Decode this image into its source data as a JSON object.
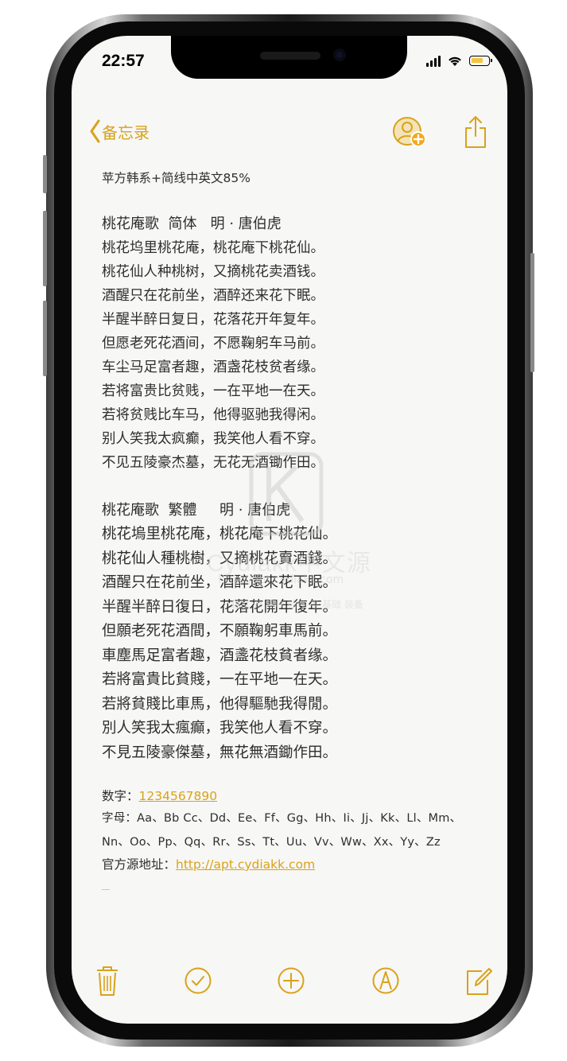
{
  "status": {
    "time": "22:57"
  },
  "nav": {
    "back_label": "备忘录"
  },
  "note": {
    "title_line": "苹方韩系+简线中英文85%",
    "simplified": {
      "heading": "桃花庵歌  简体   明 · 唐伯虎",
      "lines": [
        "桃花坞里桃花庵，桃花庵下桃花仙。",
        "桃花仙人种桃树，又摘桃花卖酒钱。",
        "酒醒只在花前坐，酒醉还来花下眠。",
        "半醒半醉日复日，花落花开年复年。",
        "但愿老死花酒间，不愿鞠躬车马前。",
        "车尘马足富者趣，酒盏花枝贫者缘。",
        "若将富贵比贫贱，一在平地一在天。",
        "若将贫贱比车马，他得驱驰我得闲。",
        "别人笑我太疯癫，我笑他人看不穿。",
        "不见五陵豪杰墓，无花无酒锄作田。"
      ]
    },
    "traditional": {
      "heading": "桃花庵歌  繁體     明 · 唐伯虎",
      "lines": [
        "桃花塢里桃花庵，桃花庵下桃花仙。",
        "桃花仙人種桃樹，又摘桃花賣酒錢。",
        "酒醒只在花前坐，酒醉還來花下眠。",
        "半醒半醉日復日，花落花開年復年。",
        "但願老死花酒間，不願鞠躬車馬前。",
        "車塵馬足富者趣，酒盞花枝貧者缘。",
        "若將富貴比貧賤，一在平地一在天。",
        "若將貧賤比車馬，他得驅馳我得閒。",
        "別人笑我太瘋癲，我笑他人看不穿。",
        "不見五陵豪傑墓，無花無酒鋤作田。"
      ]
    },
    "digits_label": "数字：",
    "digits_value": "1234567890",
    "letters_label": "字母：",
    "letters_line1": "Aa、Bb Cc、Dd、Ee、Ff、Gg、Hh、Ii、Jj、Kk、Ll、Mm、",
    "letters_line2": "Nn、Oo、Pp、Qq、Rr、Ss、Tt、Uu、Vv、Ww、Xx、Yy、Zz",
    "source_label": "官方源地址：",
    "source_url": "http://apt.cydiakk.com"
  },
  "watermark": {
    "brand": "Cydiakk中文源",
    "url": "http://apt.cydiakk.com",
    "tagline": "越狱 源 常收 插件 等 基础 装备"
  },
  "colors": {
    "accent": "#d9a21b",
    "paper": "#f7f7f5",
    "text": "#2e2e2e"
  },
  "icons": {
    "toolbar": [
      "trash-icon",
      "checklist-icon",
      "add-icon",
      "markup-icon",
      "compose-icon"
    ]
  }
}
